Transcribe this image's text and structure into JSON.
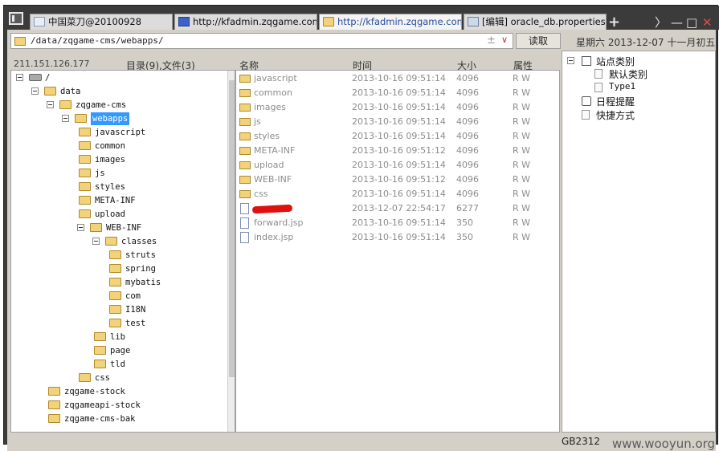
{
  "tabs": [
    {
      "label": "中国菜刀@20100928",
      "icon": "blank-page-icon",
      "active": false
    },
    {
      "label": "http://kfadmin.zqgame.com/1...",
      "icon": "web-icon",
      "active": false
    },
    {
      "label": "http://kfadmin.zqgame.com/1...",
      "icon": "folder-icon",
      "active": true
    },
    {
      "label": "[编辑] oracle_db.properties",
      "icon": "edit-icon",
      "active": false
    }
  ],
  "tabbar_controls": {
    "add": "+",
    "next": "〉",
    "minimize": "—",
    "maximize": "□",
    "close": "✕"
  },
  "address": {
    "path": "/data/zqgame-cms/webapps/",
    "pm": "±",
    "dropdown": "∨"
  },
  "read_button": "读取",
  "datebar": "星期六 2013-12-07 十一月初五",
  "left": {
    "ip": "211.151.126.177",
    "dir_count": "目录(9),文件(3)",
    "tree": [
      {
        "label": "/",
        "icon": "drive",
        "expander": true,
        "level": 0
      },
      {
        "label": "data",
        "icon": "folder",
        "expander": true,
        "level": 1
      },
      {
        "label": "zqgame-cms",
        "icon": "folder",
        "expander": true,
        "level": 2
      },
      {
        "label": "webapps",
        "icon": "folder",
        "expander": true,
        "level": 3,
        "selected": true
      },
      {
        "label": "javascript",
        "icon": "folder",
        "expander": false,
        "level": 4
      },
      {
        "label": "common",
        "icon": "folder",
        "expander": false,
        "level": 4
      },
      {
        "label": "images",
        "icon": "folder",
        "expander": false,
        "level": 4
      },
      {
        "label": "js",
        "icon": "folder",
        "expander": false,
        "level": 4
      },
      {
        "label": "styles",
        "icon": "folder",
        "expander": false,
        "level": 4
      },
      {
        "label": "META-INF",
        "icon": "folder",
        "expander": false,
        "level": 4
      },
      {
        "label": "upload",
        "icon": "folder",
        "expander": false,
        "level": 4
      },
      {
        "label": "WEB-INF",
        "icon": "folder",
        "expander": true,
        "level": 4
      },
      {
        "label": "classes",
        "icon": "folder",
        "expander": true,
        "level": 5
      },
      {
        "label": "struts",
        "icon": "folder",
        "expander": false,
        "level": 6
      },
      {
        "label": "spring",
        "icon": "folder",
        "expander": false,
        "level": 6
      },
      {
        "label": "mybatis",
        "icon": "folder",
        "expander": false,
        "level": 6
      },
      {
        "label": "com",
        "icon": "folder",
        "expander": false,
        "level": 6
      },
      {
        "label": "I18N",
        "icon": "folder",
        "expander": false,
        "level": 6
      },
      {
        "label": "test",
        "icon": "folder",
        "expander": false,
        "level": 6
      },
      {
        "label": "lib",
        "icon": "folder",
        "expander": false,
        "level": 5
      },
      {
        "label": "page",
        "icon": "folder",
        "expander": false,
        "level": 5
      },
      {
        "label": "tld",
        "icon": "folder",
        "expander": false,
        "level": 5
      },
      {
        "label": "css",
        "icon": "folder",
        "expander": false,
        "level": 4
      },
      {
        "label": "zqgame-stock",
        "icon": "folder",
        "expander": false,
        "level": 2
      },
      {
        "label": "zqgameapi-stock",
        "icon": "folder",
        "expander": false,
        "level": 2
      },
      {
        "label": "zqgame-cms-bak",
        "icon": "folder",
        "expander": false,
        "level": 2
      }
    ]
  },
  "columns": {
    "name": "名称",
    "time": "时间",
    "size": "大小",
    "attr": "属性"
  },
  "files": [
    {
      "name": "javascript",
      "time": "2013-10-16 09:51:14",
      "size": "4096",
      "attr": "R W",
      "type": "folder"
    },
    {
      "name": "common",
      "time": "2013-10-16 09:51:14",
      "size": "4096",
      "attr": "R W",
      "type": "folder"
    },
    {
      "name": "images",
      "time": "2013-10-16 09:51:14",
      "size": "4096",
      "attr": "R W",
      "type": "folder"
    },
    {
      "name": "js",
      "time": "2013-10-16 09:51:14",
      "size": "4096",
      "attr": "R W",
      "type": "folder"
    },
    {
      "name": "styles",
      "time": "2013-10-16 09:51:14",
      "size": "4096",
      "attr": "R W",
      "type": "folder"
    },
    {
      "name": "META-INF",
      "time": "2013-10-16 09:51:12",
      "size": "4096",
      "attr": "R W",
      "type": "folder"
    },
    {
      "name": "upload",
      "time": "2013-10-16 09:51:14",
      "size": "4096",
      "attr": "R W",
      "type": "folder"
    },
    {
      "name": "WEB-INF",
      "time": "2013-10-16 09:51:12",
      "size": "4096",
      "attr": "R W",
      "type": "folder"
    },
    {
      "name": "css",
      "time": "2013-10-16 09:51:14",
      "size": "4096",
      "attr": "R W",
      "type": "folder"
    },
    {
      "name": "",
      "time": "2013-12-07 22:54:17",
      "size": "6277",
      "attr": "R W",
      "type": "file",
      "redacted": true
    },
    {
      "name": "forward.jsp",
      "time": "2013-10-16 09:51:14",
      "size": "350",
      "attr": "R W",
      "type": "file"
    },
    {
      "name": "index.jsp",
      "time": "2013-10-16 09:51:14",
      "size": "350",
      "attr": "R W",
      "type": "file"
    }
  ],
  "right": {
    "items": [
      {
        "label": "站点类别",
        "kind": "category"
      },
      {
        "label": "默认类别",
        "kind": "sub"
      },
      {
        "label": "Type1",
        "kind": "sub"
      },
      {
        "label": "日程提醒",
        "kind": "reminder"
      },
      {
        "label": "快捷方式",
        "kind": "shortcut"
      }
    ]
  },
  "status": {
    "encoding": "GB2312"
  },
  "watermark": "www.wooyun.org"
}
